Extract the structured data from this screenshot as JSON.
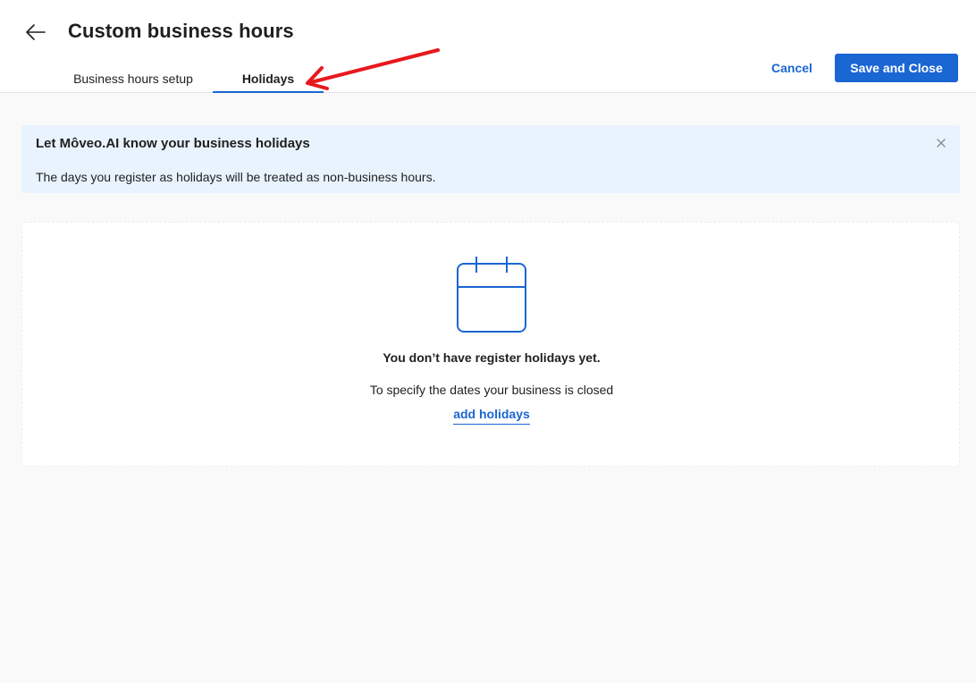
{
  "header": {
    "title": "Custom business hours",
    "back_icon": "arrow-left-icon",
    "tabs": [
      {
        "label": "Business hours setup",
        "active": false
      },
      {
        "label": "Holidays",
        "active": true
      }
    ],
    "cancel_label": "Cancel",
    "save_label": "Save and Close"
  },
  "banner": {
    "title": "Let Môveo.AI know your business holidays",
    "text": "The days you register as holidays will be treated as non-business hours.",
    "close_icon": "close-icon"
  },
  "empty_state": {
    "icon": "calendar-icon",
    "title": "You don’t have register holidays yet.",
    "text": "To specify the dates your business is closed",
    "link_label": "add holidays"
  },
  "colors": {
    "primary": "#1a66d2",
    "banner_bg": "#e9f3fe",
    "page_bg": "#f9f9f9",
    "annotation_arrow": "#e8181d"
  }
}
